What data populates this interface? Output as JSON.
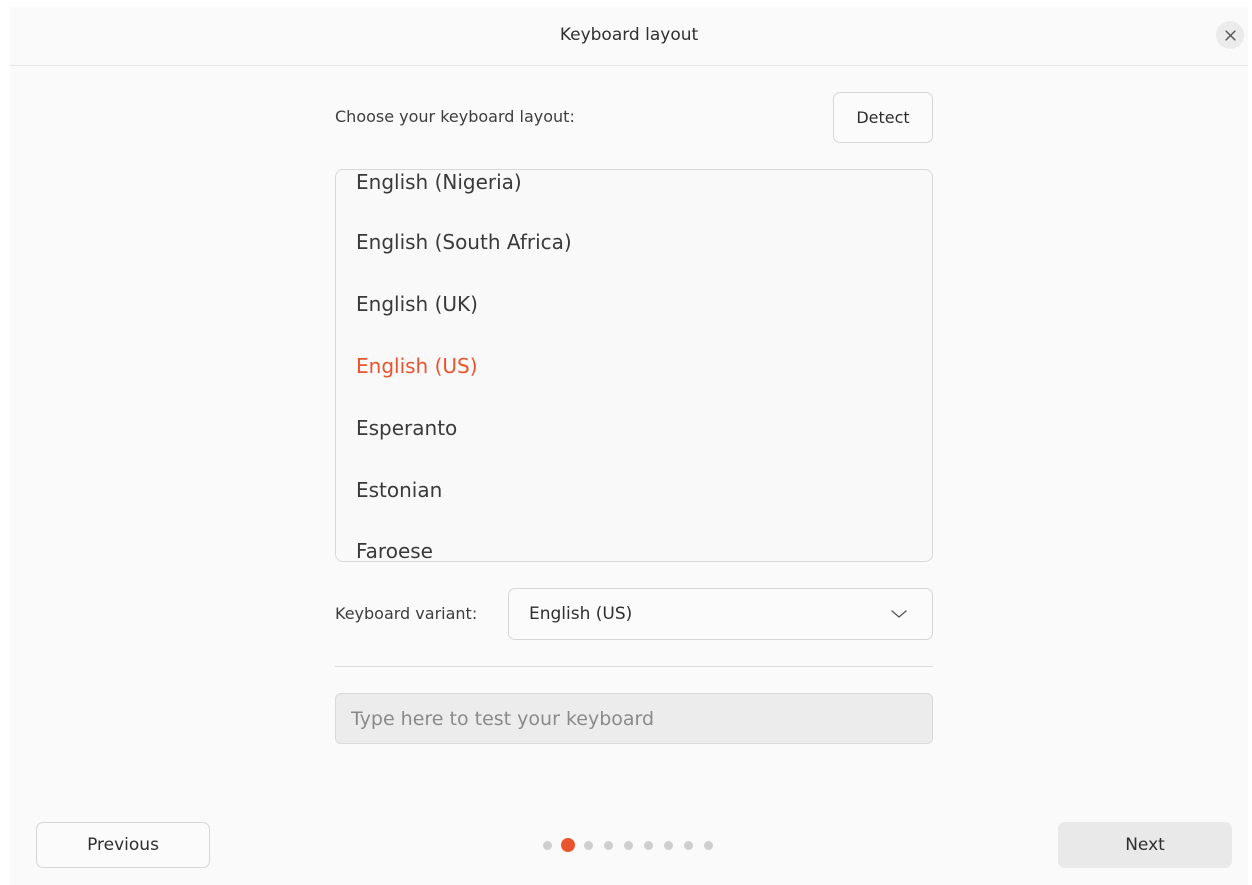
{
  "window": {
    "title": "Keyboard layout"
  },
  "layout_prompt": "Choose your keyboard layout:",
  "detect_label": "Detect",
  "layouts": [
    {
      "label": "English (Nigeria)",
      "selected": false
    },
    {
      "label": "English (South Africa)",
      "selected": false
    },
    {
      "label": "English (UK)",
      "selected": false
    },
    {
      "label": "English (US)",
      "selected": true
    },
    {
      "label": "Esperanto",
      "selected": false
    },
    {
      "label": "Estonian",
      "selected": false
    },
    {
      "label": "Faroese",
      "selected": false
    }
  ],
  "variant": {
    "label": "Keyboard variant:",
    "value": "English (US)"
  },
  "test_input": {
    "placeholder": "Type here to test your keyboard",
    "value": ""
  },
  "navigation": {
    "previous_label": "Previous",
    "next_label": "Next",
    "total_steps": 9,
    "current_step": 2
  },
  "colors": {
    "accent": "#e9542f",
    "background": "#fafafa",
    "text": "#2e2e2e"
  },
  "icons": {
    "close": "close-icon",
    "dropdown": "chevron-down-icon"
  }
}
